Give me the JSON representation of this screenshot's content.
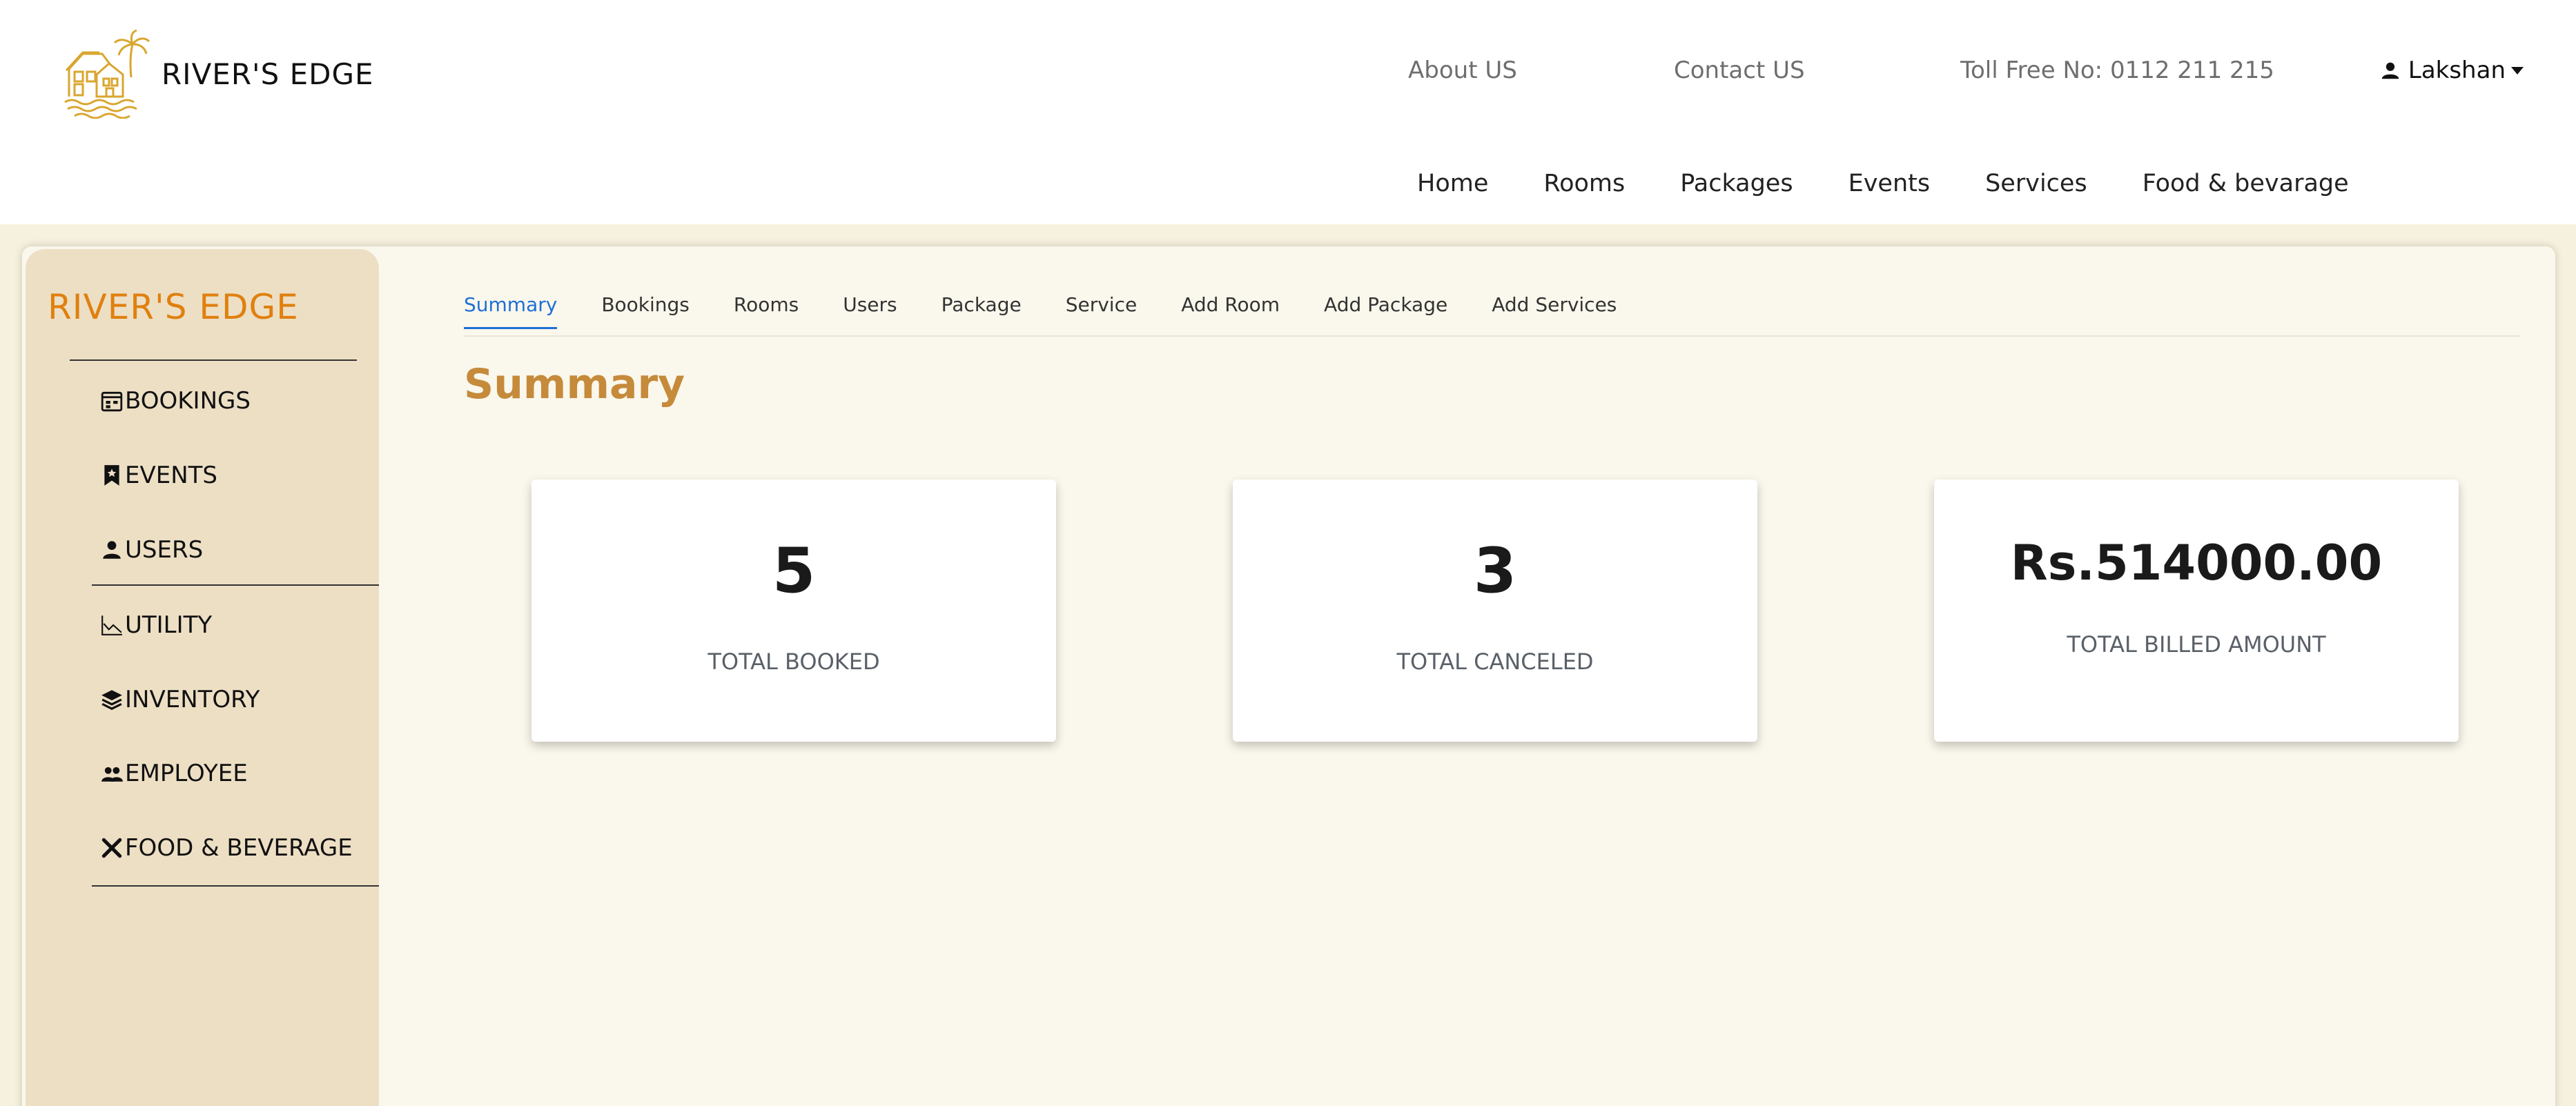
{
  "header": {
    "brand_name": "RIVER'S EDGE",
    "about": "About US",
    "contact": "Contact US",
    "toll_free": "Toll Free No: 0112 211 215",
    "user_name": "Lakshan",
    "nav": [
      "Home",
      "Rooms",
      "Packages",
      "Events",
      "Services",
      "Food & bevarage"
    ]
  },
  "sidebar": {
    "title": "RIVER'S EDGE",
    "items": [
      {
        "label": "BOOKINGS",
        "icon": "calendar-icon"
      },
      {
        "label": "EVENTS",
        "icon": "bookmark-icon"
      },
      {
        "label": "USERS",
        "icon": "user-icon"
      },
      {
        "label": "UTILITY",
        "icon": "chart-icon"
      },
      {
        "label": "INVENTORY",
        "icon": "layers-icon"
      },
      {
        "label": "EMPLOYEE",
        "icon": "people-icon"
      },
      {
        "label": "FOOD & BEVERAGE",
        "icon": "utensils-icon"
      }
    ]
  },
  "tabs": [
    "Summary",
    "Bookings",
    "Rooms",
    "Users",
    "Package",
    "Service",
    "Add Room",
    "Add Package",
    "Add Services"
  ],
  "active_tab": "Summary",
  "summary": {
    "title": "Summary",
    "cards": [
      {
        "value": "5",
        "label": "TOTAL BOOKED"
      },
      {
        "value": "3",
        "label": "TOTAL CANCELED"
      },
      {
        "value": "Rs.514000.00",
        "label": "TOTAL BILLED AMOUNT"
      }
    ]
  },
  "colors": {
    "accent_orange": "#e0800f",
    "title_brown": "#c58a3a",
    "active_tab_blue": "#1f6fd6",
    "sidebar_bg": "#eddfc4",
    "page_bg": "#f6f1de",
    "logo_gold": "#d9a62e"
  }
}
